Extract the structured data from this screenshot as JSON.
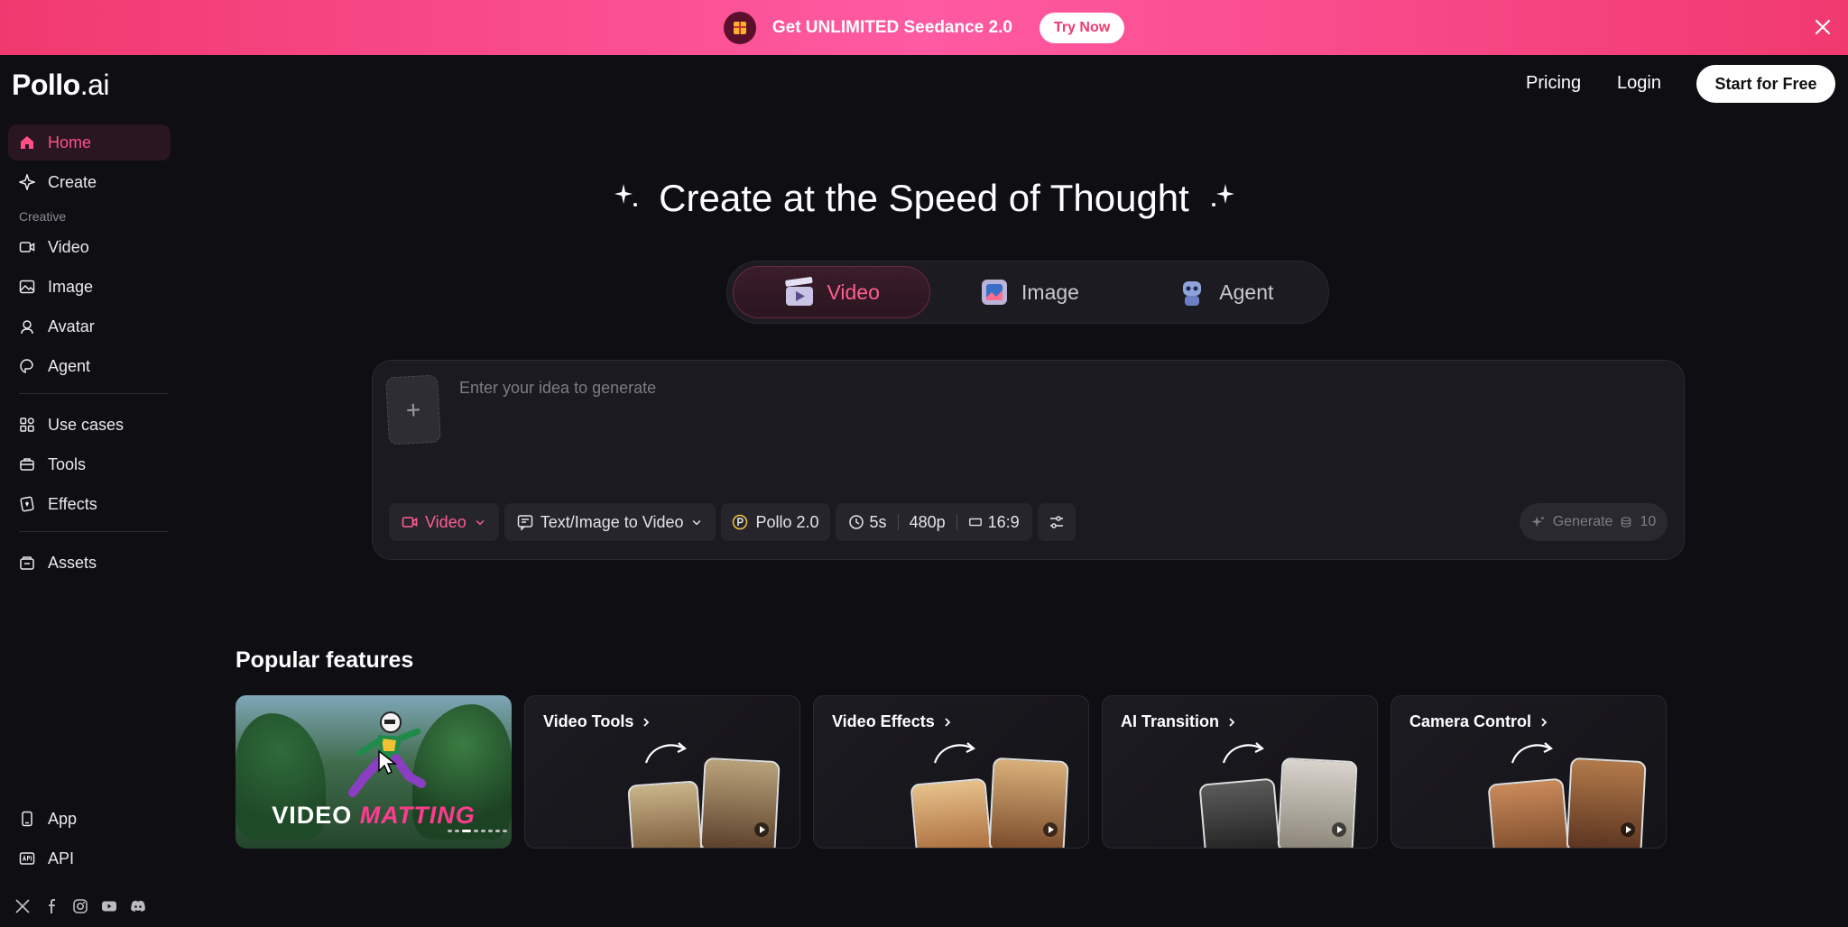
{
  "banner": {
    "text": "Get UNLIMITED Seedance 2.0",
    "cta": "Try Now"
  },
  "logo": {
    "main": "Pollo",
    "suffix": ".ai"
  },
  "nav": {
    "pricing": "Pricing",
    "login": "Login",
    "start": "Start for Free"
  },
  "sidebar": {
    "home": "Home",
    "create": "Create",
    "creative_heading": "Creative",
    "video": "Video",
    "image": "Image",
    "avatar": "Avatar",
    "agent": "Agent",
    "use_cases": "Use cases",
    "tools": "Tools",
    "effects": "Effects",
    "assets": "Assets",
    "app": "App",
    "api": "API"
  },
  "hero": {
    "title": "Create at the Speed of Thought"
  },
  "modes": {
    "video": "Video",
    "image": "Image",
    "agent": "Agent",
    "selected": "Video"
  },
  "prompt": {
    "placeholder": "Enter your idea to generate",
    "type": "Video",
    "mode": "Text/Image to Video",
    "model": "Pollo 2.0",
    "duration": "5s",
    "resolution": "480p",
    "ratio": "16:9",
    "generate": "Generate",
    "credits": "10"
  },
  "popular": {
    "title": "Popular features",
    "matting_white": "VIDEO",
    "matting_pink": "MATTING",
    "cards": [
      "Video Tools",
      "Video Effects",
      "AI Transition",
      "Camera Control"
    ]
  },
  "colors": {
    "accent": "#ff4f86",
    "banner": "#f0396f",
    "background": "#0f0e12"
  }
}
